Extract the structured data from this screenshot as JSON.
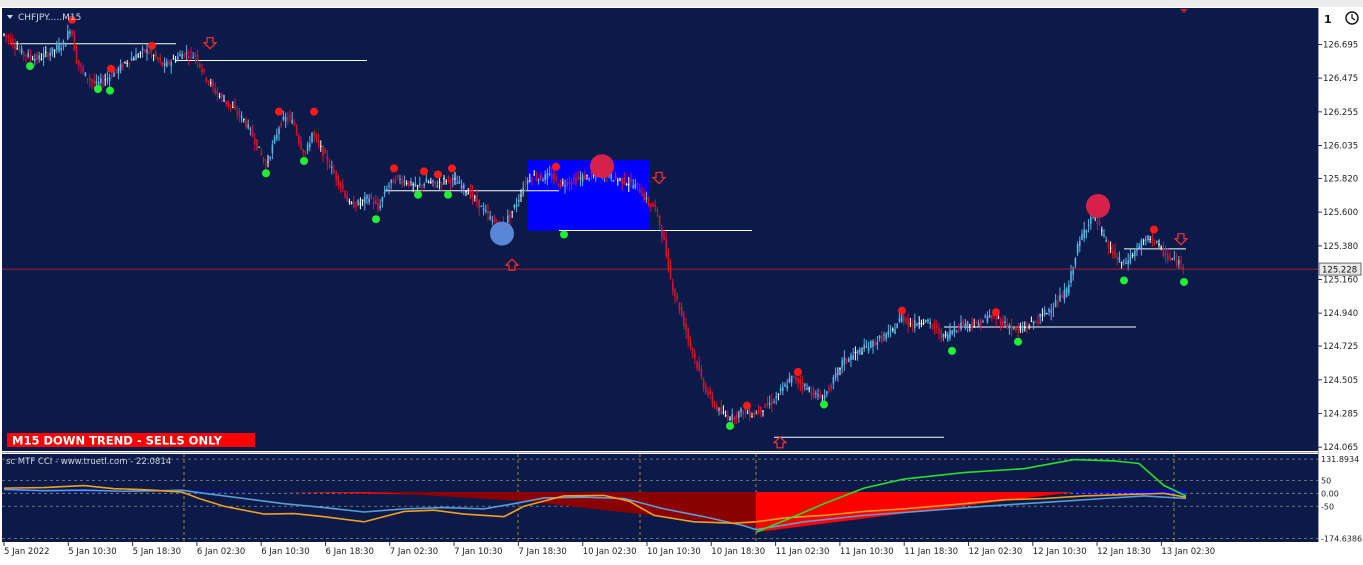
{
  "window": {
    "symbol_label": "CHFJPY.....M15",
    "trend_banner": "M15  DOWN TREND - SELLS ONLY",
    "indicator_label": "sc MTF CCI - www.truetl.com - 22.0814"
  },
  "colors": {
    "background": "#0b1a48",
    "grid": "#8a8a8a",
    "bull_candle": "#5fb2e6",
    "bear_candle": "#d2142d",
    "doji_candle": "#ffffff",
    "current_price_line": "#a8202a",
    "support_line": "#ffffff",
    "dot_high": "#ff1a1a",
    "dot_low": "#22ee33",
    "box_fill": "#0000ff",
    "banner_bg": "#ff0000",
    "cci_fast": "#f0a020",
    "cci_slow": "#5a9ed6",
    "cci_long": "#28e028",
    "cci_fill_red": "#ff0000",
    "cci_fill_dark": "#8b0000",
    "cci_fill_blue": "#0000ee"
  },
  "chart_data": {
    "type": "candlestick",
    "symbol": "CHFJPY",
    "timeframe": "M15",
    "ylim": [
      124.04,
      126.92
    ],
    "price_ticks": [
      "126.695",
      "126.475",
      "126.255",
      "126.035",
      "125.820",
      "125.600",
      "125.380",
      "125.160",
      "124.940",
      "124.725",
      "124.505",
      "124.285",
      "124.065"
    ],
    "current_price": "125.228",
    "time_ticks": [
      "5 Jan 2022",
      "5 Jan 10:30",
      "5 Jan 18:30",
      "6 Jan 02:30",
      "6 Jan 10:30",
      "6 Jan 18:30",
      "7 Jan 02:30",
      "7 Jan 10:30",
      "7 Jan 18:30",
      "10 Jan 02:30",
      "10 Jan 10:30",
      "10 Jan 18:30",
      "11 Jan 02:30",
      "11 Jan 10:30",
      "11 Jan 18:30",
      "12 Jan 02:30",
      "12 Jan 10:30",
      "12 Jan 18:30",
      "13 Jan 02:30"
    ],
    "close_path": [
      [
        0,
        126.76
      ],
      [
        7,
        126.72
      ],
      [
        16,
        126.65
      ],
      [
        21,
        126.63
      ],
      [
        33,
        126.6
      ],
      [
        45,
        126.64
      ],
      [
        60,
        126.7
      ],
      [
        67,
        126.82
      ],
      [
        72,
        126.6
      ],
      [
        80,
        126.5
      ],
      [
        92,
        126.43
      ],
      [
        104,
        126.48
      ],
      [
        112,
        126.52
      ],
      [
        122,
        126.58
      ],
      [
        132,
        126.62
      ],
      [
        142,
        126.66
      ],
      [
        150,
        126.62
      ],
      [
        160,
        126.55
      ],
      [
        170,
        126.6
      ],
      [
        180,
        126.64
      ],
      [
        192,
        126.62
      ],
      [
        200,
        126.5
      ],
      [
        212,
        126.38
      ],
      [
        225,
        126.3
      ],
      [
        240,
        126.2
      ],
      [
        250,
        126.08
      ],
      [
        262,
        125.9
      ],
      [
        270,
        126.06
      ],
      [
        276,
        126.18
      ],
      [
        283,
        126.22
      ],
      [
        290,
        126.18
      ],
      [
        296,
        126.04
      ],
      [
        302,
        125.98
      ],
      [
        308,
        126.12
      ],
      [
        316,
        126.02
      ],
      [
        326,
        125.9
      ],
      [
        338,
        125.76
      ],
      [
        346,
        125.64
      ],
      [
        356,
        125.66
      ],
      [
        366,
        125.7
      ],
      [
        374,
        125.62
      ],
      [
        382,
        125.76
      ],
      [
        392,
        125.82
      ],
      [
        402,
        125.8
      ],
      [
        412,
        125.76
      ],
      [
        422,
        125.8
      ],
      [
        432,
        125.78
      ],
      [
        444,
        125.82
      ],
      [
        456,
        125.78
      ],
      [
        466,
        125.72
      ],
      [
        476,
        125.64
      ],
      [
        486,
        125.56
      ],
      [
        496,
        125.5
      ],
      [
        506,
        125.58
      ],
      [
        514,
        125.68
      ],
      [
        520,
        125.78
      ],
      [
        528,
        125.84
      ],
      [
        536,
        125.82
      ],
      [
        546,
        125.84
      ],
      [
        556,
        125.78
      ],
      [
        566,
        125.8
      ],
      [
        576,
        125.82
      ],
      [
        588,
        125.84
      ],
      [
        598,
        125.86
      ],
      [
        610,
        125.82
      ],
      [
        622,
        125.8
      ],
      [
        634,
        125.76
      ],
      [
        644,
        125.66
      ],
      [
        652,
        125.62
      ],
      [
        660,
        125.4
      ],
      [
        668,
        125.12
      ],
      [
        676,
        124.96
      ],
      [
        684,
        124.78
      ],
      [
        692,
        124.62
      ],
      [
        700,
        124.46
      ],
      [
        710,
        124.34
      ],
      [
        718,
        124.28
      ],
      [
        728,
        124.26
      ],
      [
        738,
        124.3
      ],
      [
        748,
        124.28
      ],
      [
        758,
        124.32
      ],
      [
        768,
        124.36
      ],
      [
        778,
        124.44
      ],
      [
        788,
        124.52
      ],
      [
        798,
        124.48
      ],
      [
        808,
        124.42
      ],
      [
        818,
        124.38
      ],
      [
        828,
        124.48
      ],
      [
        838,
        124.62
      ],
      [
        848,
        124.66
      ],
      [
        858,
        124.7
      ],
      [
        868,
        124.74
      ],
      [
        878,
        124.78
      ],
      [
        888,
        124.82
      ],
      [
        898,
        124.92
      ],
      [
        908,
        124.86
      ],
      [
        918,
        124.9
      ],
      [
        928,
        124.86
      ],
      [
        940,
        124.78
      ],
      [
        950,
        124.84
      ],
      [
        960,
        124.88
      ],
      [
        972,
        124.86
      ],
      [
        984,
        124.92
      ],
      [
        994,
        124.9
      ],
      [
        1004,
        124.86
      ],
      [
        1014,
        124.82
      ],
      [
        1024,
        124.86
      ],
      [
        1034,
        124.9
      ],
      [
        1044,
        124.96
      ],
      [
        1054,
        125.02
      ],
      [
        1064,
        125.1
      ],
      [
        1072,
        125.34
      ],
      [
        1080,
        125.48
      ],
      [
        1088,
        125.58
      ],
      [
        1094,
        125.52
      ],
      [
        1102,
        125.4
      ],
      [
        1112,
        125.3
      ],
      [
        1120,
        125.26
      ],
      [
        1128,
        125.32
      ],
      [
        1138,
        125.4
      ],
      [
        1148,
        125.44
      ],
      [
        1156,
        125.36
      ],
      [
        1164,
        125.3
      ],
      [
        1172,
        125.28
      ],
      [
        1180,
        125.24
      ]
    ],
    "high_markers": [
      [
        68,
        126.83
      ],
      [
        107,
        126.51
      ],
      [
        148,
        126.66
      ],
      [
        275,
        126.23
      ],
      [
        310,
        126.23
      ],
      [
        390,
        125.86
      ],
      [
        420,
        125.84
      ],
      [
        434,
        125.82
      ],
      [
        448,
        125.86
      ],
      [
        552,
        125.87
      ],
      [
        743,
        124.31
      ],
      [
        794,
        124.53
      ],
      [
        898,
        124.93
      ],
      [
        992,
        124.92
      ],
      [
        1150,
        125.46
      ]
    ],
    "low_markers": [
      [
        26,
        126.58
      ],
      [
        94,
        126.43
      ],
      [
        106,
        126.42
      ],
      [
        262,
        125.88
      ],
      [
        300,
        125.96
      ],
      [
        372,
        125.58
      ],
      [
        414,
        125.74
      ],
      [
        444,
        125.74
      ],
      [
        560,
        125.48
      ],
      [
        726,
        124.23
      ],
      [
        820,
        124.37
      ],
      [
        948,
        124.72
      ],
      [
        1014,
        124.78
      ],
      [
        1120,
        125.18
      ],
      [
        1180,
        125.17
      ]
    ],
    "levels": [
      {
        "from": 6,
        "to": 172,
        "price": 126.7
      },
      {
        "from": 172,
        "to": 363,
        "price": 126.59
      },
      {
        "from": 380,
        "to": 555,
        "price": 125.74
      },
      {
        "from": 555,
        "to": 748,
        "price": 125.48
      },
      {
        "from": 770,
        "to": 940,
        "price": 124.13
      },
      {
        "from": 940,
        "to": 1132,
        "price": 124.85
      },
      {
        "from": 1120,
        "to": 1182,
        "price": 125.36
      }
    ],
    "box": {
      "from": 524,
      "to": 646,
      "top": 125.94,
      "bottom": 125.48
    },
    "sell_arrows": [
      [
        206,
        126.7
      ],
      [
        655,
        125.82
      ],
      [
        1177,
        125.42
      ]
    ],
    "buy_arrows": [
      [
        508,
        125.26
      ],
      [
        776,
        124.1
      ]
    ],
    "big_circles": [
      {
        "x": 498,
        "price": 125.46,
        "color": "#5a86d8"
      },
      {
        "x": 598,
        "price": 125.9,
        "color": "#d6224a"
      },
      {
        "x": 1094,
        "price": 125.64,
        "color": "#d6224a"
      }
    ],
    "indicator": {
      "name": "sc MTF CCI",
      "value": "22.0814",
      "levels_text": [
        "131.8934",
        "50",
        "0.00",
        "-50",
        "-174.6386"
      ],
      "fast": [
        [
          0,
          20
        ],
        [
          40,
          22
        ],
        [
          80,
          30
        ],
        [
          110,
          18
        ],
        [
          140,
          14
        ],
        [
          178,
          5
        ],
        [
          195,
          -20
        ],
        [
          220,
          -50
        ],
        [
          260,
          -80
        ],
        [
          290,
          -78
        ],
        [
          320,
          -90
        ],
        [
          360,
          -110
        ],
        [
          400,
          -70
        ],
        [
          430,
          -65
        ],
        [
          460,
          -80
        ],
        [
          500,
          -90
        ],
        [
          520,
          -50
        ],
        [
          560,
          -10
        ],
        [
          600,
          -8
        ],
        [
          625,
          -30
        ],
        [
          650,
          -85
        ],
        [
          690,
          -110
        ],
        [
          730,
          -115
        ],
        [
          752,
          -110
        ],
        [
          780,
          -95
        ],
        [
          820,
          -85
        ],
        [
          860,
          -70
        ],
        [
          900,
          -60
        ],
        [
          960,
          -40
        ],
        [
          1000,
          -25
        ],
        [
          1040,
          -20
        ],
        [
          1080,
          -10
        ],
        [
          1120,
          -5
        ],
        [
          1160,
          0
        ],
        [
          1182,
          -15
        ]
      ],
      "slow": [
        [
          0,
          15
        ],
        [
          40,
          10
        ],
        [
          80,
          12
        ],
        [
          120,
          8
        ],
        [
          160,
          10
        ],
        [
          178,
          12
        ],
        [
          200,
          0
        ],
        [
          240,
          -20
        ],
        [
          280,
          -40
        ],
        [
          320,
          -55
        ],
        [
          360,
          -72
        ],
        [
          400,
          -60
        ],
        [
          440,
          -55
        ],
        [
          480,
          -60
        ],
        [
          510,
          -40
        ],
        [
          540,
          -18
        ],
        [
          580,
          -15
        ],
        [
          620,
          -20
        ],
        [
          660,
          -60
        ],
        [
          700,
          -90
        ],
        [
          740,
          -125
        ],
        [
          752,
          -140
        ],
        [
          800,
          -110
        ],
        [
          860,
          -85
        ],
        [
          920,
          -68
        ],
        [
          980,
          -50
        ],
        [
          1040,
          -35
        ],
        [
          1100,
          -20
        ],
        [
          1140,
          -10
        ],
        [
          1182,
          -20
        ]
      ],
      "long": [
        [
          752,
          -150
        ],
        [
          790,
          -90
        ],
        [
          820,
          -40
        ],
        [
          860,
          20
        ],
        [
          900,
          55
        ],
        [
          960,
          80
        ],
        [
          1020,
          95
        ],
        [
          1070,
          130
        ],
        [
          1110,
          125
        ],
        [
          1135,
          115
        ],
        [
          1160,
          30
        ],
        [
          1182,
          -10
        ]
      ]
    }
  }
}
